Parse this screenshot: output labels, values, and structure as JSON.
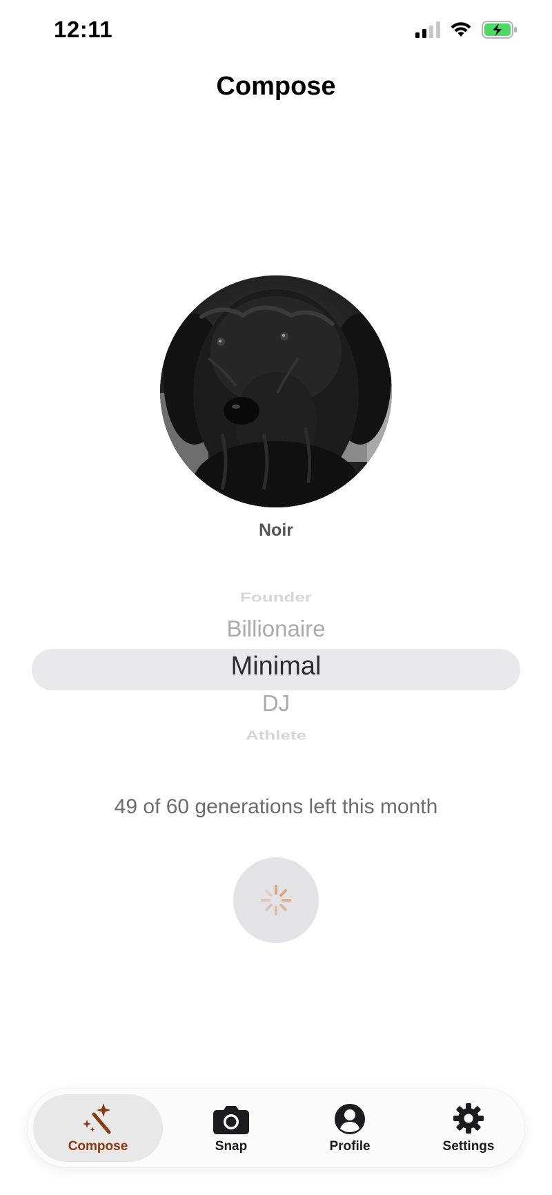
{
  "status_bar": {
    "time": "12:11",
    "icons": [
      "cellular-signal-icon",
      "wifi-icon",
      "battery-charging-icon"
    ]
  },
  "header": {
    "title": "Compose"
  },
  "avatar": {
    "description_icon": "dog-photo"
  },
  "style": {
    "name": "Noir"
  },
  "picker": {
    "items": [
      "Founder",
      "Billionaire",
      "Minimal",
      "DJ",
      "Athlete"
    ],
    "selected": "Minimal"
  },
  "quota": {
    "text": "49 of 60 generations left this month"
  },
  "generate_button": {
    "icon": "loading-spinner-icon"
  },
  "tab_bar": {
    "tabs": [
      {
        "label": "Compose",
        "icon": "magic-wand-icon",
        "active": true
      },
      {
        "label": "Snap",
        "icon": "camera-icon",
        "active": false
      },
      {
        "label": "Profile",
        "icon": "person-circle-icon",
        "active": false
      },
      {
        "label": "Settings",
        "icon": "gear-icon",
        "active": false
      }
    ]
  },
  "colors": {
    "accent": "#8a3a12",
    "spinner": "#d9a27c",
    "battery": "#4cd964"
  }
}
